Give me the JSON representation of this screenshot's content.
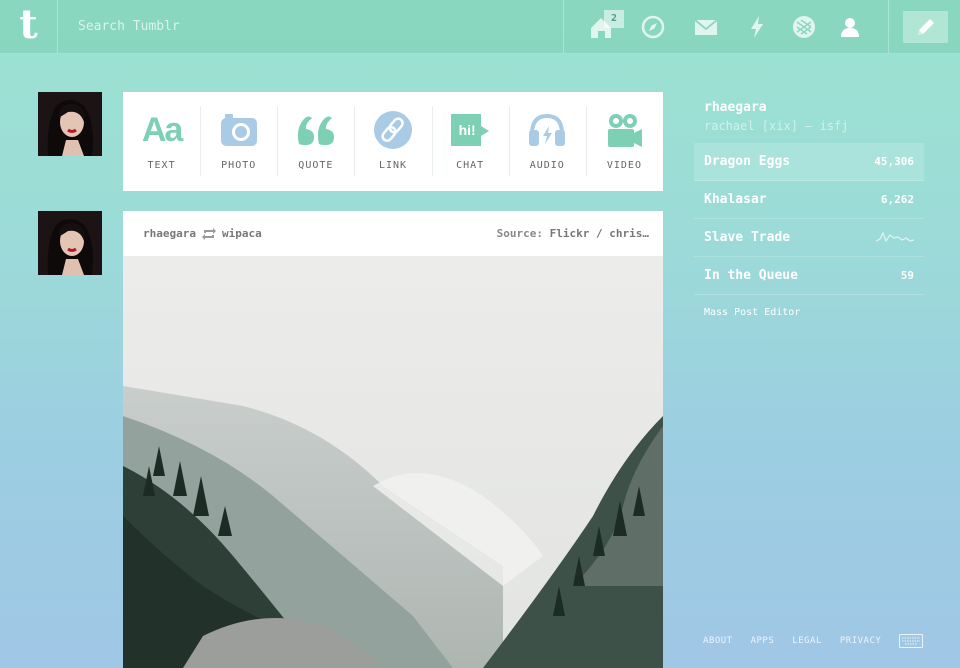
{
  "topbar": {
    "logo": "t",
    "search_placeholder": "Search Tumblr",
    "badge_count": "2",
    "icons": [
      "home-icon",
      "explore-icon",
      "inbox-icon",
      "activity-icon",
      "staff-picks-icon",
      "account-icon"
    ],
    "compose_icon": "pencil-icon"
  },
  "post_types": [
    {
      "label": "TEXT",
      "icon": "text-icon"
    },
    {
      "label": "PHOTO",
      "icon": "camera-icon"
    },
    {
      "label": "QUOTE",
      "icon": "quote-icon"
    },
    {
      "label": "LINK",
      "icon": "link-icon"
    },
    {
      "label": "CHAT",
      "icon": "chat-icon"
    },
    {
      "label": "AUDIO",
      "icon": "headphones-icon"
    },
    {
      "label": "VIDEO",
      "icon": "video-camera-icon"
    }
  ],
  "text_glyph": "Aa",
  "chat_glyph": "hi!",
  "post": {
    "author": "rhaegara",
    "reblogged_from": "wipaca",
    "source_label": "Source:",
    "source_value": "Flickr / chris…"
  },
  "sidebar": {
    "blog_name": "rhaegara",
    "blog_description": "rachael [xix] — isfj",
    "items": [
      {
        "name": "Dragon Eggs",
        "count": "45,306"
      },
      {
        "name": "Khalasar",
        "count": "6,262"
      },
      {
        "name": "Slave Trade",
        "count": ""
      },
      {
        "name": "In the Queue",
        "count": "59"
      }
    ],
    "mass_post_editor": "Mass Post Editor"
  },
  "footer": {
    "links": [
      "ABOUT",
      "APPS",
      "LEGAL",
      "PRIVACY"
    ],
    "keyboard_icon": "keyboard-icon"
  },
  "colors": {
    "accent_green": "#7ed0b4",
    "accent_blue": "#a9cbe6"
  }
}
